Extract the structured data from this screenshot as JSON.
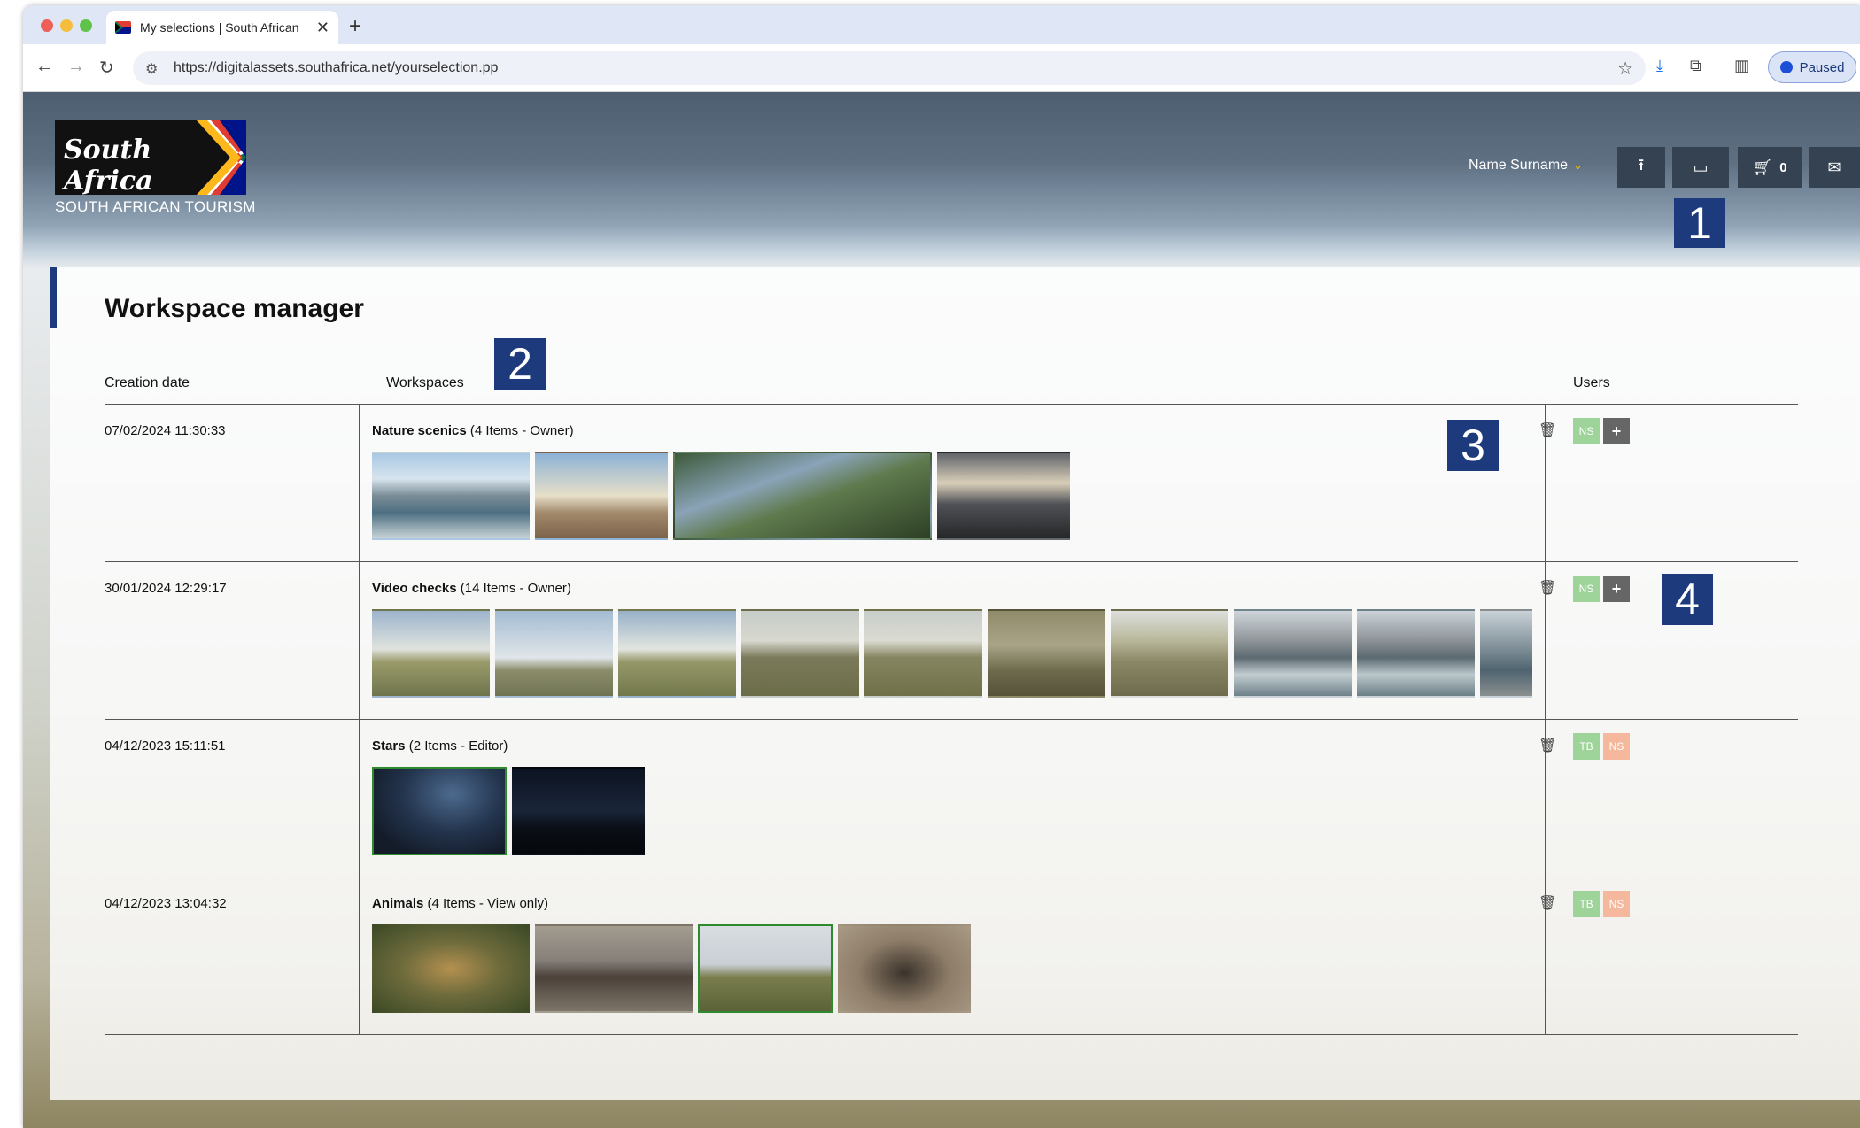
{
  "browser": {
    "tab_title": "My selections | South African",
    "tab_close": "✕",
    "new_tab": "+",
    "url": "https://digitalassets.southafrica.net/yourselection.pp",
    "profile_status": "Paused",
    "back": "←",
    "forward": "→",
    "reload": "↻"
  },
  "header": {
    "logo_script": "South Africa",
    "logo_subtitle": "SOUTH AFRICAN TOURISM",
    "user_name": "Name Surname",
    "cart_count": "0"
  },
  "markers": [
    "1",
    "2",
    "3",
    "4"
  ],
  "workspace_manager": {
    "title": "Workspace manager",
    "columns": {
      "creation_date": "Creation date",
      "workspaces": "Workspaces",
      "users": "Users"
    },
    "rows": [
      {
        "date": "07/02/2024 11:30:33",
        "name": "Nature scenics",
        "meta": "(4 Items - Owner)",
        "users": [
          "NS",
          "+"
        ]
      },
      {
        "date": "30/01/2024 12:29:17",
        "name": "Video checks",
        "meta": "(14 Items - Owner)",
        "users": [
          "NS",
          "+"
        ]
      },
      {
        "date": "04/12/2023 15:11:51",
        "name": "Stars",
        "meta": "(2 Items - Editor)",
        "users": [
          "TB",
          "NS"
        ]
      },
      {
        "date": "04/12/2023 13:04:32",
        "name": "Animals",
        "meta": "(4 Items - View only)",
        "users": [
          "TB",
          "NS"
        ]
      }
    ]
  },
  "colors": {
    "accent": "#1d3a7c",
    "user_green": "#9ed39a",
    "user_orange": "#f5b89c",
    "selected_border": "#2f8a2f"
  }
}
